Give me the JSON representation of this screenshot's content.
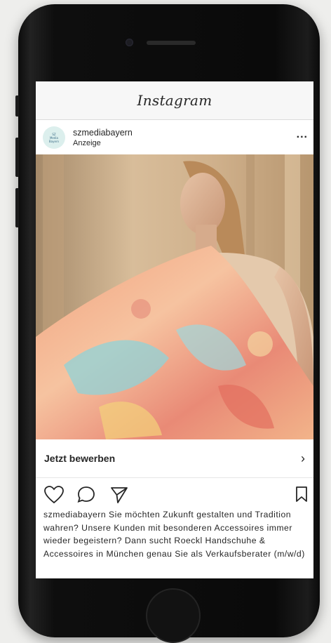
{
  "app": {
    "title": "Instagram"
  },
  "post": {
    "username": "szmediabayern",
    "sponsored_label": "Anzeige",
    "avatar_text": [
      "SZ",
      "Media",
      "Bayern"
    ],
    "more_label": "...",
    "cta_label": "Jetzt bewerben",
    "cta_chevron": "›",
    "caption_user": "szmediabayern",
    "caption_text": " Sie möchten Zukunft gestalten und Tradition wahren? Unsere Kunden mit besonderen Accessoires immer wieder begeistern? Dann sucht Roeckl Handschuhe & Accessoires in München genau Sie als Verkaufsberater (m/w/d)"
  },
  "icons": {
    "like": "heart-icon",
    "comment": "comment-icon",
    "share": "send-icon",
    "save": "bookmark-icon"
  },
  "colors": {
    "text": "#262626",
    "header_bg": "#f7f7f7",
    "divider": "#dbdbdb"
  }
}
